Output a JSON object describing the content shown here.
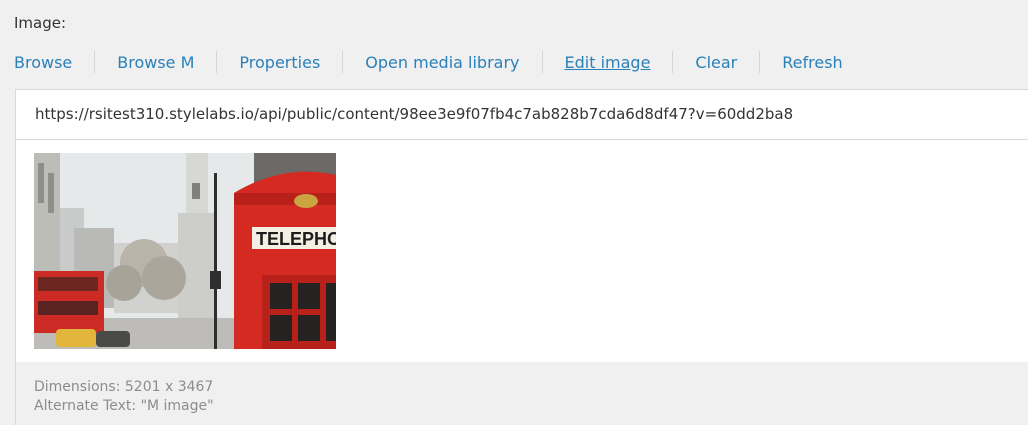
{
  "field": {
    "label": "Image:"
  },
  "toolbar": {
    "browse": "Browse",
    "browse_m": "Browse M",
    "properties": "Properties",
    "open_media_library": "Open media library",
    "edit_image": "Edit image",
    "clear": "Clear",
    "refresh": "Refresh"
  },
  "url": {
    "value": "https://rsitest310.stylelabs.io/api/public/content/98ee3e9f07fb4c7ab828b7cda6d8df47?v=60dd2ba8"
  },
  "preview": {
    "sign_text": "TELEPHO"
  },
  "info": {
    "dimensions": "Dimensions: 5201 x 3467",
    "alt_text": "Alternate Text: \"M image\""
  },
  "colors": {
    "link": "#2a80b9",
    "label": "#333333",
    "muted": "#8c8c8c",
    "panel": "#f0f0f0",
    "phone_box_red": "#d42a22"
  }
}
